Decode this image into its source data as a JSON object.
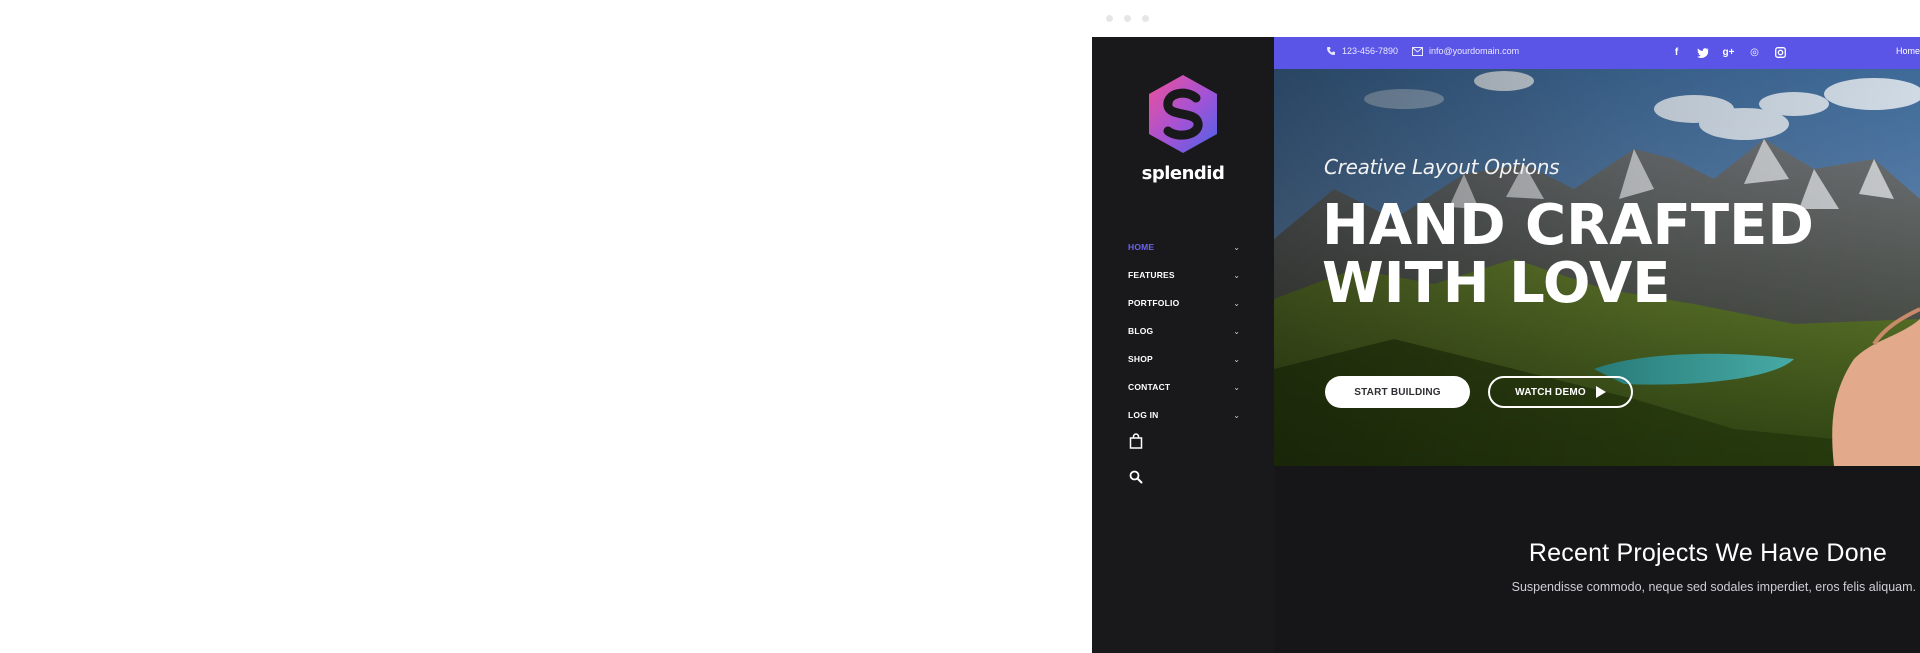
{
  "window": {
    "dots": 3
  },
  "brand": {
    "name": "splendid",
    "logo_icon": "splendid-logo-hexagon",
    "accent": "#5a55e6",
    "active_nav_color": "#6a63f0"
  },
  "sidebar": {
    "items": [
      {
        "label": "HOME",
        "active": true
      },
      {
        "label": "FEATURES",
        "active": false
      },
      {
        "label": "PORTFOLIO",
        "active": false
      },
      {
        "label": "BLOG",
        "active": false
      },
      {
        "label": "SHOP",
        "active": false
      },
      {
        "label": "CONTACT",
        "active": false
      },
      {
        "label": "LOG IN",
        "active": false
      }
    ],
    "icons": [
      "shopping-bag-icon",
      "search-icon"
    ]
  },
  "topbar": {
    "phone": "123-456-7890",
    "email": "info@yourdomain.com",
    "social": [
      {
        "name": "facebook-icon",
        "glyph": "f"
      },
      {
        "name": "twitter-icon",
        "glyph": "t"
      },
      {
        "name": "google-plus-icon",
        "glyph": "g+"
      },
      {
        "name": "dribbble-icon",
        "glyph": "◎"
      },
      {
        "name": "instagram-icon",
        "glyph": "◙"
      }
    ],
    "home_link": "Home"
  },
  "hero": {
    "kicker": "Creative Layout Options",
    "headline_line1": "HAND CRAFTED",
    "headline_line2": "WITH LOVE",
    "primary_button": "START BUILDING",
    "secondary_button": "WATCH DEMO"
  },
  "section": {
    "title": "Recent Projects We Have Done",
    "subtitle": "Suspendisse commodo, neque sed sodales imperdiet, eros felis aliquam."
  }
}
